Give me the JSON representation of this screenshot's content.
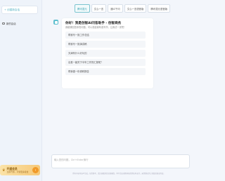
{
  "sidebar": {
    "new_chat_label": "+ 创建新会话",
    "history": [
      {
        "label": "新的会话"
      }
    ],
    "member": {
      "title": "开通会员",
      "subtitle": "立即开通，享受更多权益",
      "arrow": "›"
    }
  },
  "tabs": [
    {
      "label": "腾讯混元",
      "active": true
    },
    {
      "label": "文心一言",
      "active": false
    },
    {
      "label": "通义千问",
      "active": false
    },
    {
      "label": "文心一言语音版",
      "active": false
    },
    {
      "label": "腾讯混元语音版",
      "active": false
    }
  ],
  "welcome": {
    "title": "你好！我是创智AI问答助手 - 创智商务",
    "subtitle": "我能够回答你的问题，可以说给我听或写作，让我试一试吧！",
    "suggestions": [
      "帮我写一篇工作总结",
      "帮我写一篇演讲稿",
      "天津有什么好玩的",
      "出差一趟关于半年工作的汇报呢？",
      "帮我做一份调研报告"
    ]
  },
  "input": {
    "placeholder": "输入您的问题，Ctrl+Enter换行"
  },
  "disclaimer": "所有内容均由AI生成，仅供参考，请注意甄别信息准确性。本平台由创智科技提供技术支持，未经授权禁止转载或商业用途。",
  "colors": {
    "accent": "#3aa3b4",
    "sidebar_bg": "#eef3fa",
    "page_bg": "#f3f6fb",
    "member_gold": "#f6c97a"
  }
}
